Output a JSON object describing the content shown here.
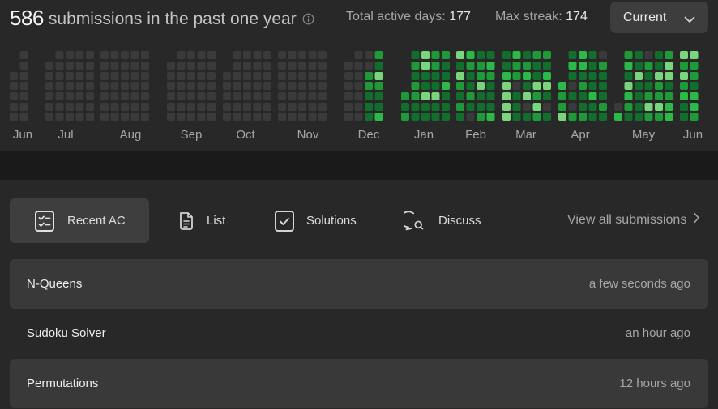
{
  "header": {
    "submission_count": "586",
    "submission_label": "submissions in the past one year",
    "active_days_label": "Total active days:",
    "active_days_value": "177",
    "max_streak_label": "Max streak:",
    "max_streak_value": "174",
    "period_selector": "Current"
  },
  "heatmap": {
    "months": [
      "Jun",
      "Jul",
      "Aug",
      "Sep",
      "Oct",
      "Nov",
      "Dec",
      "Jan",
      "Feb",
      "Mar",
      "Apr",
      "May",
      "Jun"
    ],
    "colors": {
      "empty": "#3a3a3a",
      "level1": "#126e2d",
      "level2": "#1f9a38",
      "level3": "#2bba47",
      "level4": "#7ad57c"
    }
  },
  "tabs": [
    {
      "label": "Recent AC",
      "icon": "checklist-icon"
    },
    {
      "label": "List",
      "icon": "document-icon"
    },
    {
      "label": "Solutions",
      "icon": "solution-check-icon"
    },
    {
      "label": "Discuss",
      "icon": "discuss-icon"
    }
  ],
  "view_all_label": "View all submissions",
  "submissions": [
    {
      "title": "N-Queens",
      "time": "a few seconds ago"
    },
    {
      "title": "Sudoku Solver",
      "time": "an hour ago"
    },
    {
      "title": "Permutations",
      "time": "12 hours ago"
    }
  ]
}
